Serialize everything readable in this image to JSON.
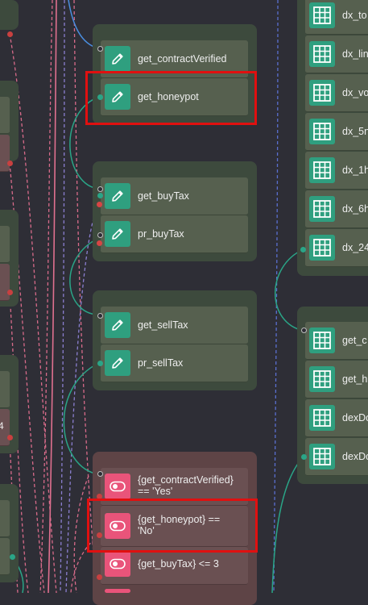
{
  "middle_column": {
    "group1": {
      "nodes": [
        {
          "label": "get_contractVerified",
          "icon": "pencil-icon"
        },
        {
          "label": "get_honeypot",
          "icon": "pencil-icon"
        }
      ]
    },
    "group2": {
      "nodes": [
        {
          "label": "get_buyTax",
          "icon": "pencil-icon"
        },
        {
          "label": "pr_buyTax",
          "icon": "pencil-icon"
        }
      ]
    },
    "group3": {
      "nodes": [
        {
          "label": "get_sellTax",
          "icon": "pencil-icon"
        },
        {
          "label": "pr_sellTax",
          "icon": "pencil-icon"
        }
      ]
    },
    "conditions": {
      "nodes": [
        {
          "label": "{get_contractVerified} == 'Yes'",
          "icon": "toggle-icon"
        },
        {
          "label": "{get_honeypot} == 'No'",
          "icon": "toggle-icon"
        },
        {
          "label": "{get_buyTax} <= 3",
          "icon": "toggle-icon"
        }
      ]
    }
  },
  "right_column": {
    "group1": {
      "nodes": [
        {
          "label": "dx_to",
          "icon": "table-icon"
        },
        {
          "label": "dx_lin",
          "icon": "table-icon"
        },
        {
          "label": "dx_vo",
          "icon": "table-icon"
        },
        {
          "label": "dx_5n",
          "icon": "table-icon"
        },
        {
          "label": "dx_1h",
          "icon": "table-icon"
        },
        {
          "label": "dx_6h",
          "icon": "table-icon"
        },
        {
          "label": "dx_24",
          "icon": "table-icon"
        }
      ]
    },
    "group2": {
      "nodes": [
        {
          "label": "get_c",
          "icon": "table-icon"
        },
        {
          "label": "get_h",
          "icon": "table-icon"
        },
        {
          "label": "dexDo",
          "icon": "table-icon"
        },
        {
          "label": "dexDo",
          "icon": "table-icon"
        }
      ]
    }
  },
  "left_edge": {
    "cut_text": "4"
  },
  "highlight_color": "#e01010"
}
